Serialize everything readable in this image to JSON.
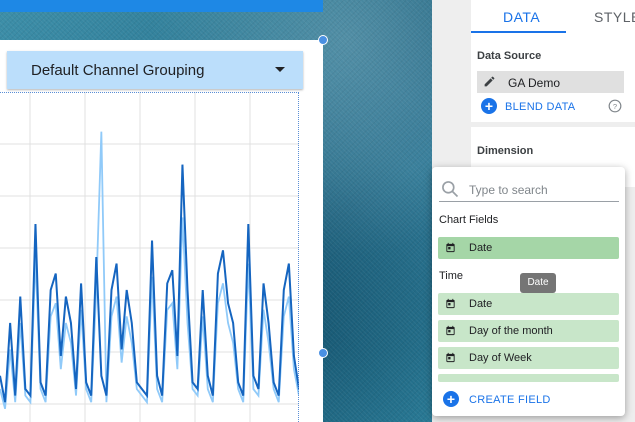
{
  "colors": {
    "accent": "#1a73e8",
    "chip": "#c8e6c9",
    "chip_selected": "#a5d6a7",
    "control": "#bbdefb",
    "series_dark": "#1565c0",
    "series_light": "#90caf9"
  },
  "chart": {
    "control_label": "Default Channel Grouping"
  },
  "panel": {
    "tabs": [
      {
        "label": "DATA"
      },
      {
        "label": "STYLE"
      }
    ],
    "data_source_title": "Data Source",
    "source_name": "GA Demo",
    "blend_label": "BLEND DATA",
    "dimension_title": "Dimension"
  },
  "picker": {
    "search_placeholder": "Type to search",
    "chart_fields_label": "Chart Fields",
    "chart_fields": [
      "Date"
    ],
    "time_label": "Time",
    "time_fields": [
      "Date",
      "Day of the month",
      "Day of Week"
    ],
    "tooltip": "Date",
    "create_label": "CREATE FIELD"
  },
  "icons": {
    "search": "search-icon",
    "edit": "pencil-icon",
    "help": "help-icon",
    "plus": "plus-icon",
    "calendar": "calendar-icon",
    "caret": "caret-down-icon"
  },
  "chart_data": {
    "type": "line",
    "title": "",
    "xlabel": "",
    "ylabel": "",
    "grid": true,
    "x": [
      0,
      1,
      2,
      3,
      4,
      5,
      6,
      7,
      8,
      9,
      10,
      11,
      12,
      13,
      14,
      15,
      16,
      17,
      18,
      19,
      20,
      21,
      22,
      23,
      24,
      25,
      26,
      27,
      28,
      29,
      30,
      31,
      32,
      33,
      34,
      35,
      36,
      37,
      38,
      39,
      40,
      41,
      42,
      43,
      44,
      45,
      46,
      47,
      48,
      49,
      50,
      51,
      52,
      53,
      54,
      55,
      56,
      57,
      58,
      59
    ],
    "ylim": [
      0,
      100
    ],
    "series": [
      {
        "values": [
          14,
          6,
          30,
          8,
          38,
          10,
          8,
          60,
          12,
          8,
          40,
          45,
          20,
          38,
          30,
          10,
          42,
          12,
          8,
          50,
          14,
          8,
          40,
          48,
          22,
          40,
          30,
          12,
          10,
          8,
          55,
          14,
          8,
          42,
          46,
          20,
          78,
          40,
          12,
          10,
          40,
          14,
          8,
          45,
          52,
          36,
          30,
          12,
          8,
          60,
          14,
          10,
          42,
          30,
          12,
          8,
          40,
          48,
          20,
          10
        ]
      },
      {
        "values": [
          10,
          4,
          22,
          6,
          30,
          8,
          6,
          50,
          10,
          6,
          32,
          36,
          16,
          30,
          24,
          8,
          34,
          10,
          6,
          40,
          88,
          6,
          32,
          38,
          18,
          32,
          24,
          10,
          8,
          6,
          44,
          10,
          6,
          34,
          36,
          16,
          62,
          30,
          10,
          8,
          32,
          10,
          6,
          36,
          42,
          30,
          24,
          10,
          6,
          48,
          10,
          8,
          34,
          24,
          10,
          6,
          32,
          38,
          16,
          8
        ]
      }
    ]
  }
}
